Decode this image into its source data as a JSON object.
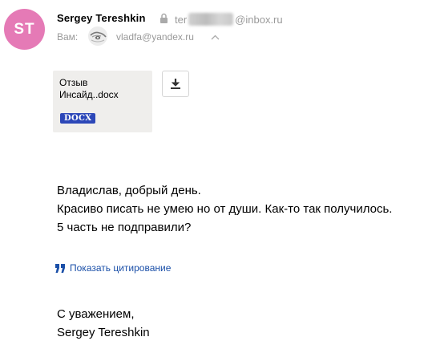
{
  "header": {
    "avatar_initials": "ST",
    "avatar_color": "#e57ab6",
    "sender_name": "Sergey Tereshkin",
    "sender_email_prefix": "ter",
    "sender_email_suffix": "@inbox.ru",
    "to_label": "Вам:",
    "recipient_email": "vladfa@yandex.ru"
  },
  "attachment": {
    "name": "Отзыв\nИнсайд..docx",
    "type_badge": "DOCX",
    "badge_color": "#2c47b8"
  },
  "message": {
    "lines": [
      "Владислав, добрый день.",
      "Красиво писать не умею но от души. Как-то так получилось.",
      "5 часть не подправили?"
    ],
    "quote_toggle_label": "Показать цитирование",
    "signature_lines": [
      "С уважением,",
      "Sergey Tereshkin"
    ]
  },
  "link_color": "#1a4fa8"
}
